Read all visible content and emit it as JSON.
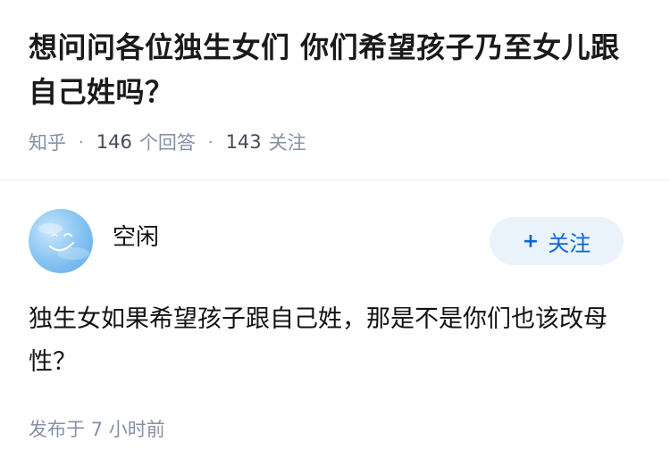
{
  "question": {
    "title": "想问问各位独生女们 你们希望孩子乃至女儿跟自己姓吗？",
    "source": "知乎",
    "answers_count": "146",
    "answers_label": "个回答",
    "followers_count": "143",
    "followers_label": "关注"
  },
  "answer": {
    "author_name": "空闲",
    "follow_plus": "+",
    "follow_label": "关注",
    "content": "独生女如果希望孩子跟自己姓，那是不是你们也该改母性？",
    "published_prefix": "发布于",
    "published_time": "7 小时前"
  },
  "colors": {
    "follow_button_bg": "#eaf2fb",
    "follow_button_text": "#0a66d8",
    "meta_text": "#8590a6"
  },
  "icons": {
    "avatar": "avatar-sky-smile"
  }
}
